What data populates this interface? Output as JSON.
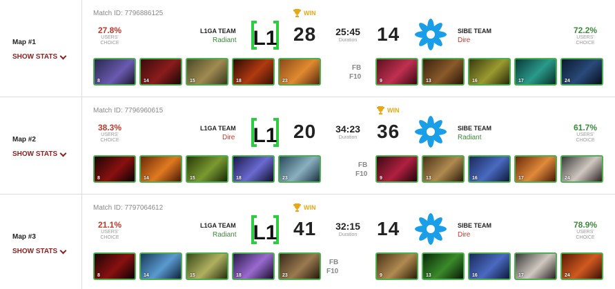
{
  "maps": [
    {
      "label": "Map #1",
      "show_stats": "SHOW STATS",
      "match_id": "Match ID: 7796886125",
      "left": {
        "pct": "27.8%",
        "choice": [
          "USERS'",
          "CHOICE"
        ],
        "team": "L1GA TEAM",
        "side": "Radiant",
        "score": "28"
      },
      "right": {
        "pct": "72.2%",
        "choice": [
          "USERS'",
          "CHOICE"
        ],
        "team": "SIBE TEAM",
        "side": "Dire",
        "score": "14"
      },
      "duration": "25:45",
      "duration_label": "Duration",
      "win": "WIN",
      "win_side": "left",
      "fb": "FB",
      "f10": "F10",
      "left_heroes": [
        "8",
        "14",
        "15",
        "18",
        "23"
      ],
      "right_heroes": [
        "9",
        "13",
        "16",
        "17",
        "24"
      ]
    },
    {
      "label": "Map #2",
      "show_stats": "SHOW STATS",
      "match_id": "Match ID: 7796960615",
      "left": {
        "pct": "38.3%",
        "choice": [
          "USERS'",
          "CHOICE"
        ],
        "team": "L1GA TEAM",
        "side": "Dire",
        "score": "20"
      },
      "right": {
        "pct": "61.7%",
        "choice": [
          "USERS'",
          "CHOICE"
        ],
        "team": "SIBE TEAM",
        "side": "Radiant",
        "score": "36"
      },
      "duration": "34:23",
      "duration_label": "Duration",
      "win": "WIN",
      "win_side": "right",
      "fb": "FB",
      "f10": "F10",
      "left_heroes": [
        "8",
        "14",
        "15",
        "18",
        "23"
      ],
      "right_heroes": [
        "9",
        "13",
        "16",
        "17",
        "24"
      ]
    },
    {
      "label": "Map #3",
      "show_stats": "SHOW STATS",
      "match_id": "Match ID: 7797064612",
      "left": {
        "pct": "21.1%",
        "choice": [
          "USERS'",
          "CHOICE"
        ],
        "team": "L1GA TEAM",
        "side": "Radiant",
        "score": "41"
      },
      "right": {
        "pct": "78.9%",
        "choice": [
          "USERS'",
          "CHOICE"
        ],
        "team": "SIBE TEAM",
        "side": "Dire",
        "score": "14"
      },
      "duration": "32:15",
      "duration_label": "Duration",
      "win": "WIN",
      "win_side": "left",
      "fb": "FB",
      "f10": "F10",
      "left_heroes": [
        "8",
        "14",
        "15",
        "18",
        "23"
      ],
      "right_heroes": [
        "9",
        "13",
        "16",
        "17",
        "24"
      ]
    }
  ],
  "colors": {
    "accent_red": "#8d1f1f",
    "win_gold": "#e6a817",
    "hero_border": "#4caf50",
    "logo_green": "#2ecc40",
    "sibe_blue": "#1a9ee8"
  }
}
